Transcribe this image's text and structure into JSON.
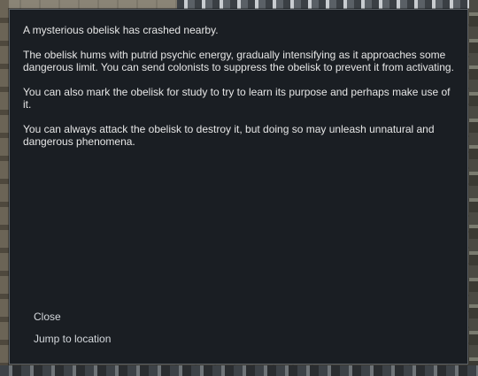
{
  "dialog": {
    "paragraphs": [
      "A mysterious obelisk has crashed nearby.",
      "The obelisk hums with putrid psychic energy, gradually intensifying as it approaches some dangerous limit. You can send colonists to suppress the obelisk to prevent it from activating.",
      "You can also mark the obelisk for study to try to learn its purpose and perhaps make use of it.",
      "You can always attack the obelisk to destroy it, but doing so may unleash unnatural and dangerous phenomena."
    ],
    "options": {
      "close_label": "Close",
      "jump_label": "Jump to location"
    }
  },
  "colors": {
    "dialog_background": "#1a1e23",
    "dialog_border": "#5b6166",
    "body_text": "#e6e6e6",
    "option_text": "#d4d8dc"
  }
}
